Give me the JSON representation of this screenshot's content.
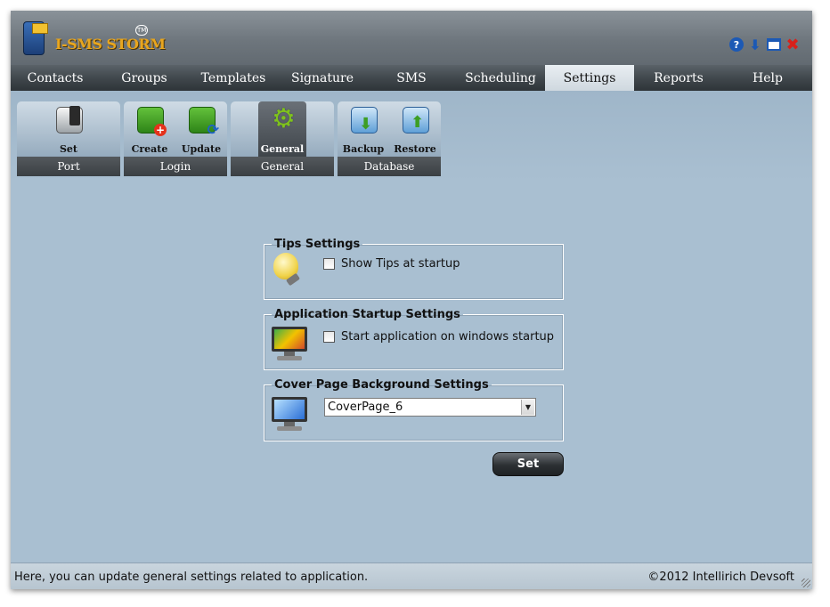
{
  "app": {
    "logo_text": "I-SMS STORM",
    "tm": "TM"
  },
  "window_controls": [
    "help-icon",
    "download-icon",
    "minimize-icon",
    "close-icon"
  ],
  "menu": {
    "items": [
      "Contacts",
      "Groups",
      "Templates",
      "Signature",
      "SMS",
      "Scheduling",
      "Settings",
      "Reports",
      "Help"
    ],
    "active": "Settings"
  },
  "toolbar": {
    "groups": [
      {
        "label": "Port",
        "tools": [
          {
            "label": "Set",
            "icon": "phone-icon"
          }
        ]
      },
      {
        "label": "Login",
        "tools": [
          {
            "label": "Create",
            "icon": "create-login-icon"
          },
          {
            "label": "Update",
            "icon": "update-login-icon"
          }
        ]
      },
      {
        "label": "General",
        "tools": [
          {
            "label": "General",
            "icon": "gear-icon",
            "selected": true
          }
        ]
      },
      {
        "label": "Database",
        "tools": [
          {
            "label": "Backup",
            "icon": "backup-icon"
          },
          {
            "label": "Restore",
            "icon": "restore-icon"
          }
        ]
      }
    ]
  },
  "tips": {
    "legend": "Tips Settings",
    "checkbox_label": "Show Tips at startup",
    "checked": false
  },
  "startup": {
    "legend": "Application Startup Settings",
    "checkbox_label": "Start application on windows startup",
    "checked": false
  },
  "cover": {
    "legend": "Cover Page Background Settings",
    "selected": "CoverPage_6"
  },
  "set_button": "Set",
  "status": {
    "text": "Here, you can update general settings related to application.",
    "copyright": "©2012 Intellirich Devsoft"
  },
  "colors": {
    "accent_gold": "#e9a61e",
    "menu_bg": "#41484d",
    "content_bg": "#a9bfd1"
  }
}
